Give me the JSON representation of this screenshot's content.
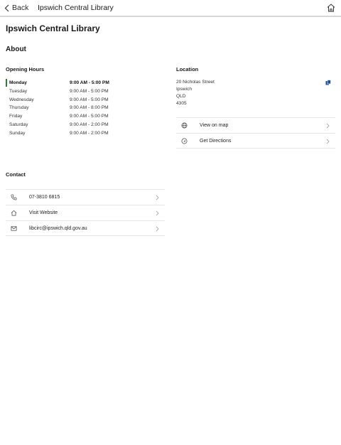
{
  "nav": {
    "back_label": "Back",
    "title": "Ipswich Central Library",
    "home_icon": "home-icon"
  },
  "page": {
    "title": "Ipswich Central Library",
    "about_heading": "About"
  },
  "opening_hours": {
    "heading": "Opening Hours",
    "rows": [
      {
        "day": "Monday",
        "time": "9:00 AM - 5:00 PM",
        "today": true
      },
      {
        "day": "Tuesday",
        "time": "9:00 AM - 5:00 PM"
      },
      {
        "day": "Wednesday",
        "time": "9:00 AM - 5:00 PM"
      },
      {
        "day": "Thursday",
        "time": "9:00 AM - 8:00 PM"
      },
      {
        "day": "Friday",
        "time": "9:00 AM - 5:00 PM"
      },
      {
        "day": "Saturday",
        "time": "9:00 AM - 2:00 PM"
      },
      {
        "day": "Sunday",
        "time": "9:00 AM - 2:00 PM"
      }
    ],
    "today_color": "#2e7d32"
  },
  "location": {
    "heading": "Location",
    "address_lines": [
      "20 Nicholas Street",
      "Ipswich",
      "QLD",
      "4305"
    ],
    "copy_icon": "copy-icon",
    "actions": [
      {
        "label": "View on map",
        "icon": "globe-icon"
      },
      {
        "label": "Get Directions",
        "icon": "directions-icon"
      }
    ]
  },
  "contact": {
    "heading": "Contact",
    "items": [
      {
        "label": "07-3810 6815",
        "icon": "phone-icon"
      },
      {
        "label": "Visit Website",
        "icon": "home-icon"
      },
      {
        "label": "libcirc@ipswich.qld.gov.au",
        "icon": "mail-icon"
      }
    ]
  },
  "colors": {
    "accent_blue": "#1f4fa0",
    "divider": "#e6e6e6"
  }
}
